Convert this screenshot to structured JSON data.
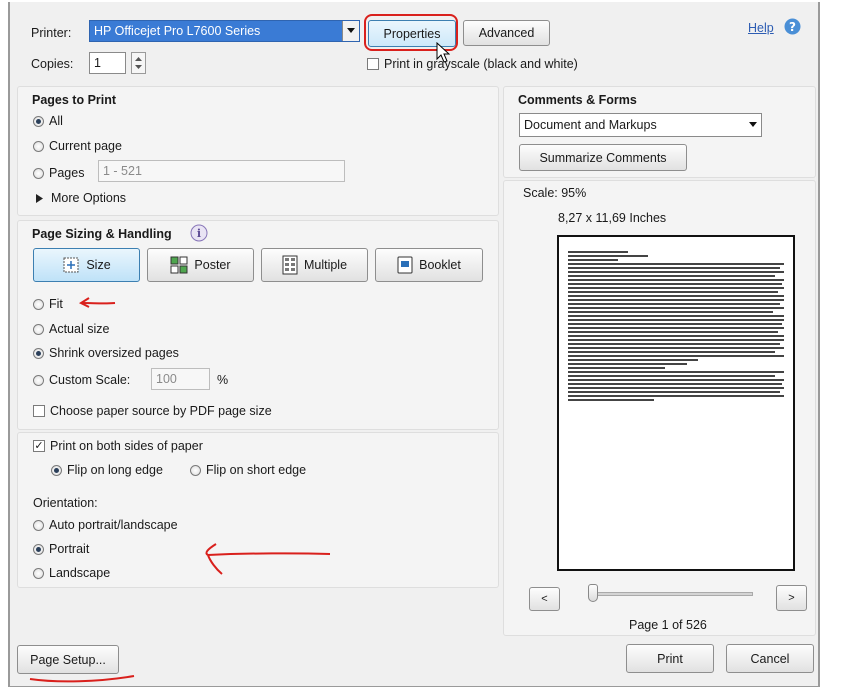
{
  "printer": {
    "label": "Printer:",
    "selected": "HP Officejet Pro L7600 Series",
    "properties_label": "Properties",
    "advanced_label": "Advanced",
    "copies_label": "Copies:",
    "copies_value": "1",
    "grayscale_label": "Print in grayscale (black and white)",
    "grayscale_checked": false
  },
  "help": {
    "label": "Help",
    "icon": "question-icon"
  },
  "pages_to_print": {
    "title": "Pages to Print",
    "options": [
      {
        "label": "All",
        "selected": true
      },
      {
        "label": "Current page",
        "selected": false
      },
      {
        "label": "Pages",
        "selected": false
      }
    ],
    "pages_range": "1 - 521",
    "more_options": "More Options"
  },
  "page_sizing": {
    "title": "Page Sizing & Handling",
    "modes": [
      {
        "label": "Size",
        "icon": "size-icon",
        "selected": true
      },
      {
        "label": "Poster",
        "icon": "poster-icon",
        "selected": false
      },
      {
        "label": "Multiple",
        "icon": "multiple-icon",
        "selected": false
      },
      {
        "label": "Booklet",
        "icon": "booklet-icon",
        "selected": false
      }
    ],
    "options": [
      {
        "label": "Fit",
        "selected": false
      },
      {
        "label": "Actual size",
        "selected": false
      },
      {
        "label": "Shrink oversized pages",
        "selected": true
      },
      {
        "label": "Custom Scale:",
        "selected": false
      }
    ],
    "custom_scale": "100",
    "percent": "%",
    "paper_source_label": "Choose paper source by PDF page size",
    "paper_source_checked": false
  },
  "duplex": {
    "both_sides_label": "Print on both sides of paper",
    "both_sides_checked": true,
    "flip_long": "Flip on long edge",
    "flip_short": "Flip on short edge",
    "flip_selected": "long"
  },
  "orientation": {
    "label": "Orientation:",
    "options": [
      {
        "label": "Auto portrait/landscape",
        "selected": false
      },
      {
        "label": "Portrait",
        "selected": true
      },
      {
        "label": "Landscape",
        "selected": false
      }
    ]
  },
  "comments_forms": {
    "title": "Comments & Forms",
    "selected": "Document and Markups",
    "summarize_label": "Summarize Comments"
  },
  "preview": {
    "scale": "Scale:  95%",
    "size": "8,27 x 11,69 Inches",
    "prev_label": "<",
    "next_label": ">",
    "page_status": "Page 1 of 526",
    "slider_fraction": 0
  },
  "footer": {
    "page_setup_label": "Page Setup...",
    "print_label": "Print",
    "cancel_label": "Cancel"
  },
  "colors": {
    "annotation_red": "#d9201c",
    "selection_blue": "#3a7bd5",
    "link_blue": "#2d5db3"
  }
}
